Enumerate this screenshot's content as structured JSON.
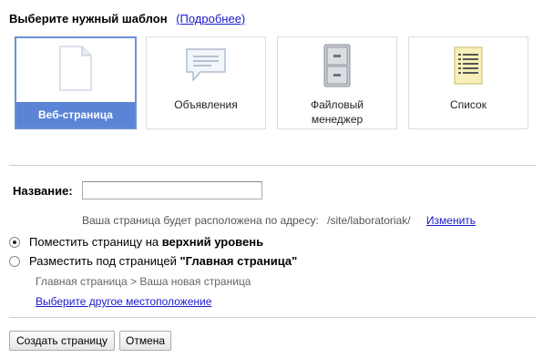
{
  "header": {
    "title": "Выберите нужный шаблон",
    "more_link": "(Подробнее)"
  },
  "templates": [
    {
      "label": "Веб-страница",
      "selected": true
    },
    {
      "label": "Объявления",
      "selected": false
    },
    {
      "label_line1": "Файловый",
      "label_line2": "менеджер",
      "selected": false
    },
    {
      "label": "Список",
      "selected": false
    }
  ],
  "form": {
    "name_label": "Название:",
    "name_value": "",
    "address_text": "Ваша страница будет расположена по адресу:",
    "address_path": "/site/laboratoriak/",
    "change_link": "Изменить"
  },
  "location": {
    "option1_prefix": "Поместить страницу на ",
    "option1_bold": "верхний уровень",
    "option2_prefix": "Разместить под страницей ",
    "option2_bold": "\"Главная страница\"",
    "selected": 1,
    "breadcrumb": "Главная страница > Ваша новая страница",
    "other_link": "Выберите другое местоположение"
  },
  "buttons": {
    "create": "Создать страницу",
    "cancel": "Отмена"
  }
}
